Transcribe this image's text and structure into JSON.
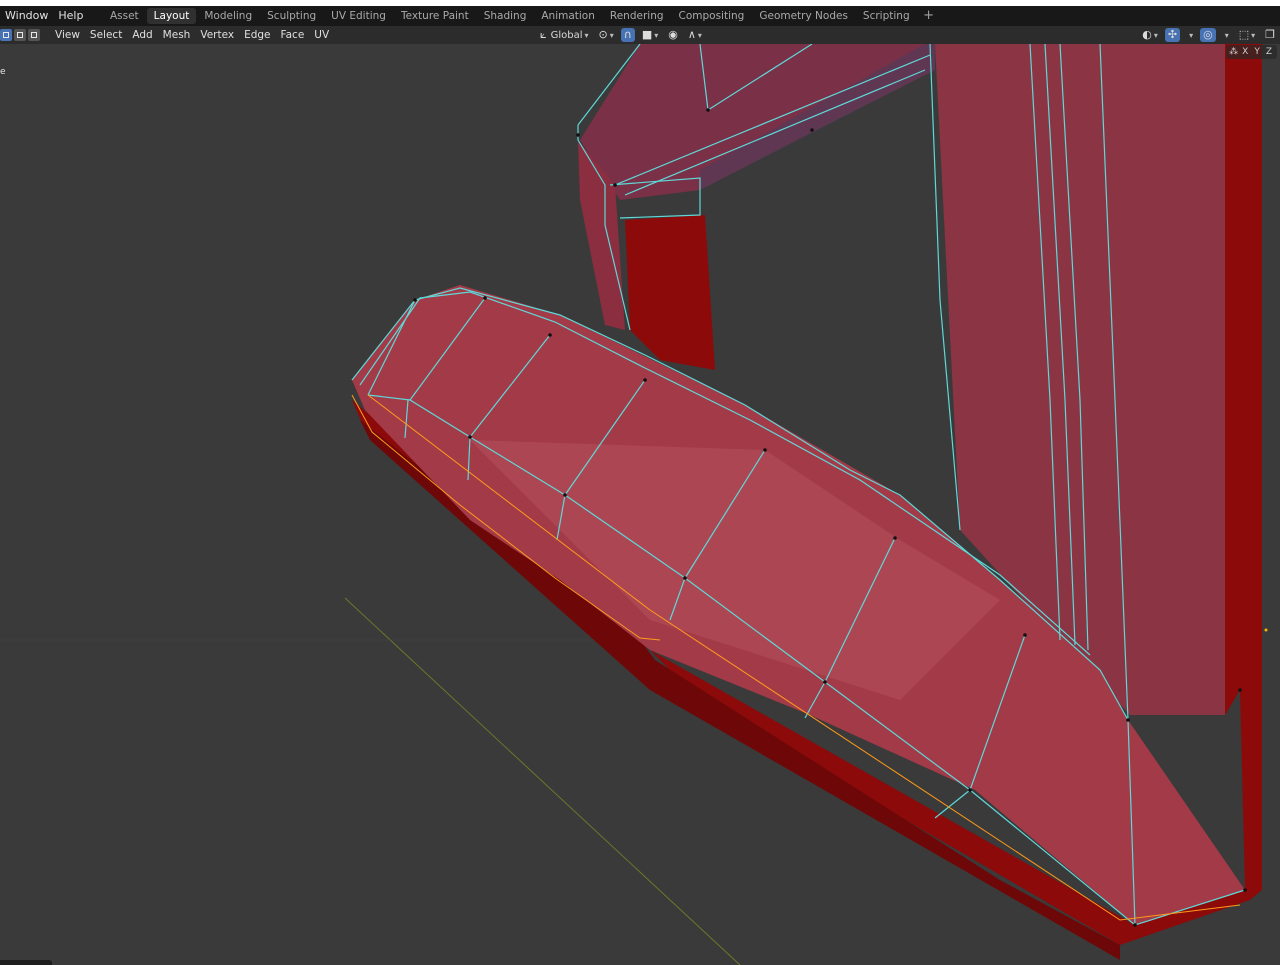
{
  "menubar": {
    "items": [
      "Window",
      "Help"
    ],
    "workspace_tabs": [
      {
        "label": "Asset",
        "active": false
      },
      {
        "label": "Layout",
        "active": true
      },
      {
        "label": "Modeling",
        "active": false
      },
      {
        "label": "Sculpting",
        "active": false
      },
      {
        "label": "UV Editing",
        "active": false
      },
      {
        "label": "Texture Paint",
        "active": false
      },
      {
        "label": "Shading",
        "active": false
      },
      {
        "label": "Animation",
        "active": false
      },
      {
        "label": "Rendering",
        "active": false
      },
      {
        "label": "Compositing",
        "active": false
      },
      {
        "label": "Geometry Nodes",
        "active": false
      },
      {
        "label": "Scripting",
        "active": false
      }
    ],
    "add_tab": "+"
  },
  "header": {
    "menus": [
      "View",
      "Select",
      "Add",
      "Mesh",
      "Vertex",
      "Edge",
      "Face",
      "UV"
    ],
    "transform_orientation": "Global",
    "select_modes": [
      "vertex-select",
      "edge-select",
      "face-select"
    ],
    "active_select_mode": "vertex-select"
  },
  "gizmo": {
    "axes": [
      "X",
      "Y",
      "Z"
    ]
  },
  "viewport": {
    "overlay_text": "e",
    "colors": {
      "background": "#3a3a3a",
      "mesh_face": "#a33a48",
      "mesh_dark": "#8c0a0a",
      "selected_edge": "#5fd8d8",
      "active_edge": "#ff9a1a",
      "grid_line": "#6a7a2a"
    }
  },
  "icons": {
    "pivot": "pivot-point-icon",
    "snap": "snap-magnet-icon",
    "proportional": "proportional-edit-icon",
    "visibility": "eye-icon",
    "gizmos": "gizmo-icon",
    "overlays": "overlay-icon",
    "xray": "xray-icon"
  }
}
